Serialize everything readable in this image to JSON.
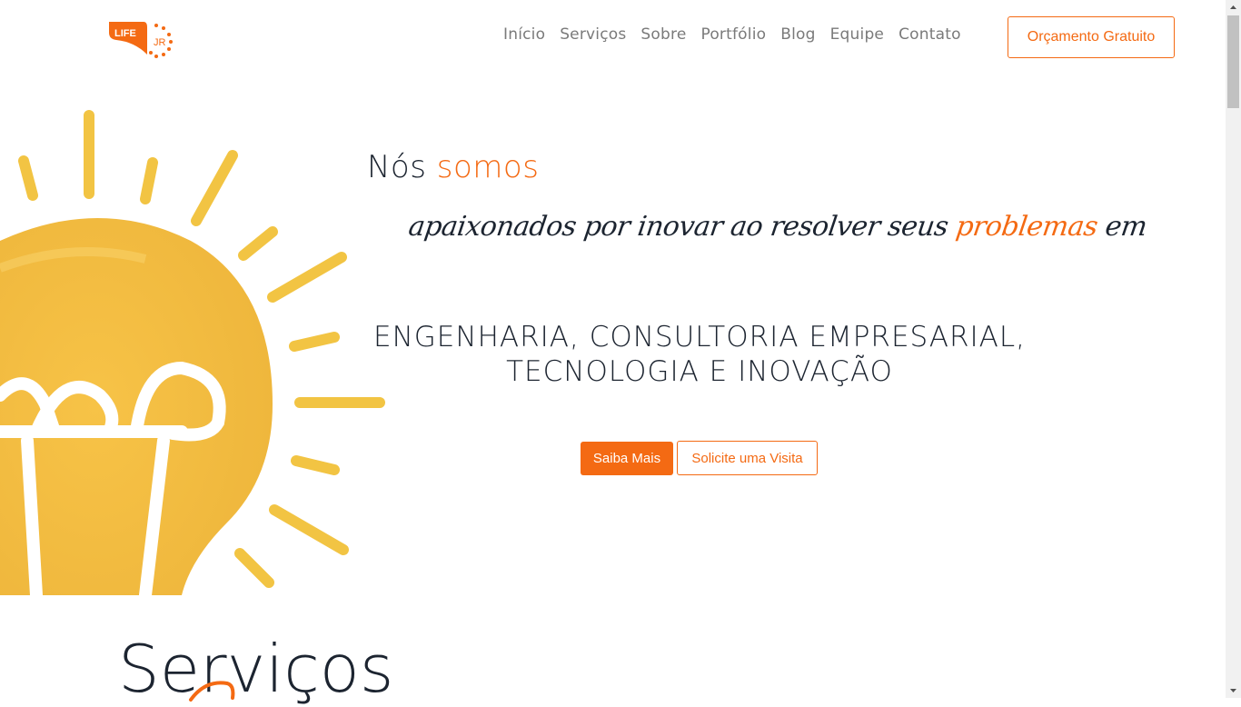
{
  "brand": {
    "logo_left": "LIFE",
    "logo_right": "JR",
    "accent": "#f46a13",
    "text_dark": "#1c2430"
  },
  "nav": {
    "items": [
      {
        "label": "Início",
        "name": "nav-inicio"
      },
      {
        "label": "Serviços",
        "name": "nav-servicos"
      },
      {
        "label": "Sobre",
        "name": "nav-sobre"
      },
      {
        "label": "Portfólio",
        "name": "nav-portfolio"
      },
      {
        "label": "Blog",
        "name": "nav-blog"
      },
      {
        "label": "Equipe",
        "name": "nav-equipe"
      },
      {
        "label": "Contato",
        "name": "nav-contato"
      }
    ],
    "cta_label": "Orçamento Gratuito"
  },
  "hero": {
    "line1_plain": "Nós",
    "line1_accent": "somos",
    "script_plain": "apaixonados por inovar ao resolver seus",
    "script_accent": "problemas",
    "script_end": "em",
    "areas_line1": "ENGENHARIA, CONSULTORIA EMPRESARIAL,",
    "areas_line2": "TECNOLOGIA E INOVAÇÃO",
    "btn_primary": "Saiba Mais",
    "btn_secondary": "Solicite uma Visita",
    "illustration": "lightbulb-icon"
  },
  "services": {
    "title": "Serviços"
  }
}
